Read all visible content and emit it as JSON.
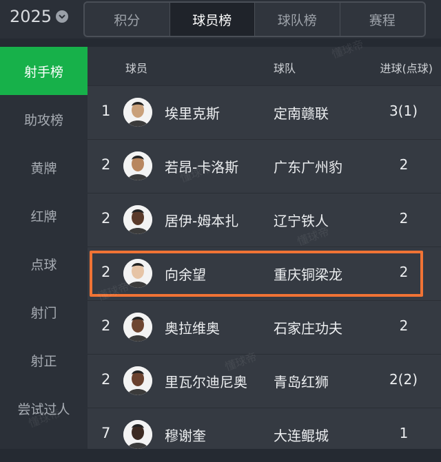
{
  "season": {
    "year": "2025"
  },
  "tabs": [
    {
      "label": "积分"
    },
    {
      "label": "球员榜"
    },
    {
      "label": "球队榜"
    },
    {
      "label": "赛程"
    }
  ],
  "sidebar": {
    "items": [
      {
        "label": "射手榜"
      },
      {
        "label": "助攻榜"
      },
      {
        "label": "黄牌"
      },
      {
        "label": "红牌"
      },
      {
        "label": "点球"
      },
      {
        "label": "射门"
      },
      {
        "label": "射正"
      },
      {
        "label": "尝试过人"
      }
    ]
  },
  "table": {
    "headers": {
      "player": "球员",
      "team": "球队",
      "goals": "进球(点球)"
    },
    "rows": [
      {
        "rank": "1",
        "name": "埃里克斯",
        "team": "定南赣联",
        "goals": "3(1)",
        "skin": "#c9a07a"
      },
      {
        "rank": "2",
        "name": "若昂-卡洛斯",
        "team": "广东广州豹",
        "goals": "2",
        "skin": "#b8865f"
      },
      {
        "rank": "2",
        "name": "居伊-姆本扎",
        "team": "辽宁铁人",
        "goals": "2",
        "skin": "#5a3a2a"
      },
      {
        "rank": "2",
        "name": "向余望",
        "team": "重庆铜梁龙",
        "goals": "2",
        "skin": "#e6c4a6"
      },
      {
        "rank": "2",
        "name": "奥拉维奥",
        "team": "石家庄功夫",
        "goals": "2",
        "skin": "#6e4631"
      },
      {
        "rank": "2",
        "name": "里瓦尔迪尼奥",
        "team": "青岛红狮",
        "goals": "2(2)",
        "skin": "#6a412e"
      },
      {
        "rank": "7",
        "name": "穆谢奎",
        "team": "大连鲲城",
        "goals": "1",
        "skin": "#3c2a22"
      }
    ]
  },
  "watermark": "懂球帝",
  "colors": {
    "accent": "#17b14a",
    "highlight": "#f07335"
  }
}
